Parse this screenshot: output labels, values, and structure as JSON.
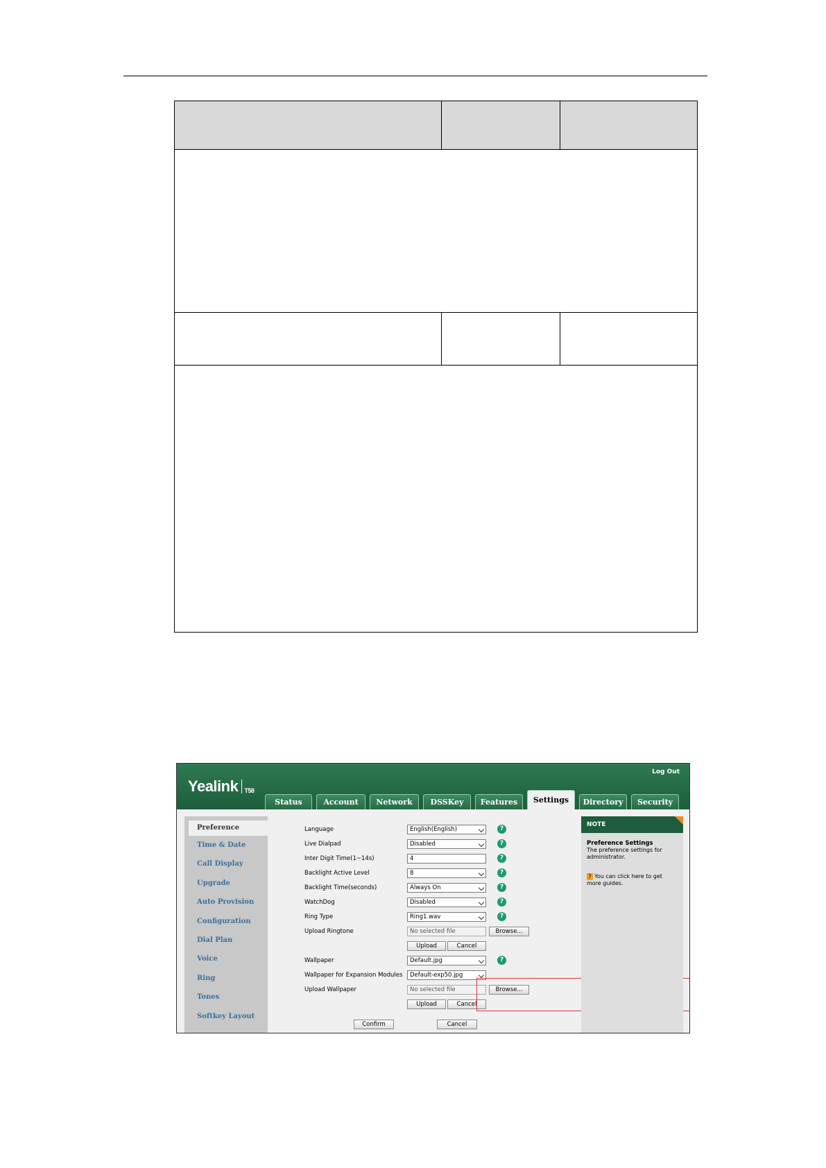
{
  "shot": {
    "logo_text": "Yealink",
    "model": "T58",
    "logout": "Log Out",
    "tabs": [
      "Status",
      "Account",
      "Network",
      "DSSKey",
      "Features",
      "Settings",
      "Directory",
      "Security"
    ],
    "active_tab": "Settings",
    "sidebar": [
      "Preference",
      "Time & Date",
      "Call Display",
      "Upgrade",
      "Auto Provision",
      "Configuration",
      "Dial Plan",
      "Voice",
      "Ring",
      "Tones",
      "Softkey Layout"
    ],
    "form": {
      "language": {
        "label": "Language",
        "value": "English(English)"
      },
      "live_dialpad": {
        "label": "Live Dialpad",
        "value": "Disabled"
      },
      "inter_digit": {
        "label": "Inter Digit Time(1~14s)",
        "value": "4"
      },
      "backlight_level": {
        "label": "Backlight Active Level",
        "value": "8"
      },
      "backlight_time": {
        "label": "Backlight Time(seconds)",
        "value": "Always On"
      },
      "watchdog": {
        "label": "WatchDog",
        "value": "Disabled"
      },
      "ring_type": {
        "label": "Ring Type",
        "value": "Ring1.wav"
      },
      "upload_ringtone": {
        "label": "Upload Ringtone",
        "value": "No selected file"
      },
      "wallpaper": {
        "label": "Wallpaper",
        "value": "Default.jpg"
      },
      "wallpaper_exp": {
        "label": "Wallpaper for Expansion Modules",
        "value": "Default-exp50.jpg"
      },
      "upload_wallpaper": {
        "label": "Upload Wallpaper",
        "value": "No selected file"
      }
    },
    "buttons": {
      "browse": "Browse...",
      "upload": "Upload",
      "cancel": "Cancel",
      "confirm": "Confirm"
    },
    "help_glyph": "?",
    "note": {
      "heading": "NOTE",
      "title": "Preference Settings",
      "text": "The preference settings for administrator.",
      "tip": "You can click here to get more guides.",
      "tip_glyph": "?"
    },
    "colors": {
      "brand_green": "#1d5d3c",
      "sidebar_link": "#3c6f9c",
      "help_icon": "#1e9a70",
      "highlight": "#dd3333",
      "note_corner": "#f08a1c"
    }
  }
}
